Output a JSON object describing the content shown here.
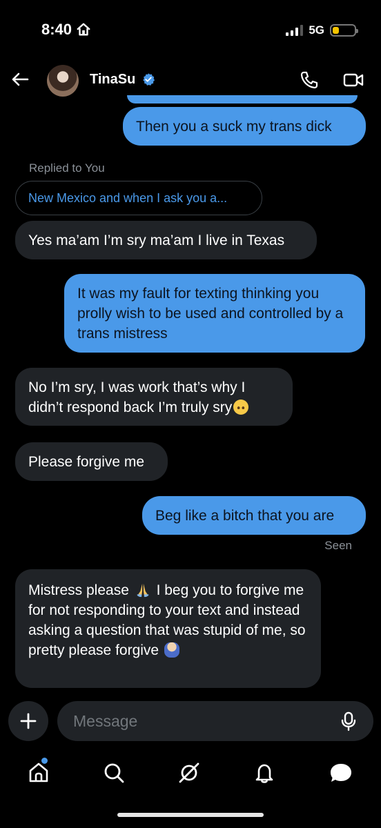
{
  "status": {
    "time": "8:40",
    "network": "5G",
    "battery_level": 0.3
  },
  "header": {
    "name": "TinaSu",
    "verified": true
  },
  "messages": {
    "m1": "Then you a suck my trans dick",
    "reply_label": "Replied to You",
    "reply_quote": "New Mexico and when I ask you a...",
    "m2": "Yes ma’am I’m sry ma’am I live in Texas",
    "m3": "It was my fault for texting thinking you prolly wish to be used and controlled by a trans mistress",
    "m4": "No I’m sry, I was work that’s why I didn’t respond back I’m truly sry",
    "m5": "Please forgive me",
    "m6": "Beg like a bitch that you are",
    "seen": "Seen",
    "m7a": "Mistress please",
    "m7b": "I beg you to forgive me for not responding to your text and instead asking a question that was stupid of me, so pretty please forgive"
  },
  "composer": {
    "placeholder": "Message"
  },
  "icons": {
    "home_status": "home-icon",
    "back": "back-arrow-icon",
    "verified": "verified-badge-icon",
    "call": "phone-icon",
    "video": "video-call-icon",
    "plus": "plus-icon",
    "mic": "microphone-icon",
    "nav": [
      "home-icon",
      "search-icon",
      "grok-icon",
      "bell-icon",
      "messages-icon"
    ]
  },
  "colors": {
    "accent": "#4a99e9",
    "received_bubble": "#202327",
    "background": "#000000"
  }
}
